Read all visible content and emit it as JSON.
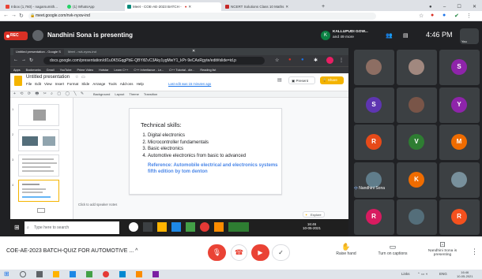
{
  "outer_browser": {
    "tabs": [
      {
        "label": "Inbox (1,760) - nagarsumith..."
      },
      {
        "label": "(1) WhatsApp"
      },
      {
        "label": "Meet - COE-AE-2023 BATCH -"
      },
      {
        "label": "NCERT Solutions Class 10 Maths"
      }
    ],
    "url": "meet.google.com/nvk-nyxw-ind"
  },
  "meet": {
    "rec_label": "REC",
    "presenting_text": "Nandhini Sona is presenting",
    "top_user": {
      "initials": "K",
      "name": "KALLUPUDI GOW...",
      "sub": "and 49 more"
    },
    "time": "4:46 PM",
    "you_label": "You",
    "pinned_name": "Nandhini Sona",
    "meeting_name": "COE-AE-2023 BATCH-QUIZ FOR AUTOMOTIVE ...",
    "raise_hand": "Raise hand",
    "captions": "Turn on captions",
    "present_label": "Nandhini Sona is presenting",
    "participants": [
      {
        "initial": "",
        "color": "#8d6e63"
      },
      {
        "initial": "",
        "color": "#a1887f"
      },
      {
        "initial": "S",
        "color": "#8e24aa"
      },
      {
        "initial": "S",
        "color": "#5e35b1"
      },
      {
        "initial": "",
        "color": "#795548"
      },
      {
        "initial": "Y",
        "color": "#8e24aa"
      },
      {
        "initial": "R",
        "color": "#e64a19"
      },
      {
        "initial": "V",
        "color": "#2e7d32"
      },
      {
        "initial": "M",
        "color": "#ef6c00"
      },
      {
        "initial": "",
        "color": "#607d8b"
      },
      {
        "initial": "K",
        "color": "#ef6c00"
      },
      {
        "initial": "",
        "color": "#78909c"
      },
      {
        "initial": "R",
        "color": "#d81b60"
      },
      {
        "initial": "",
        "color": "#546e7a"
      },
      {
        "initial": "R",
        "color": "#f4511e"
      }
    ]
  },
  "shared": {
    "inner_tabs": [
      {
        "label": "Untitled presentation - Google S"
      },
      {
        "label": "Meet - nvk-nyxw-ind"
      }
    ],
    "inner_url": "docs.google.com/presentation/d/1u0K5GqgPbE-QBYifZvC3Aky1ygMwY1_kPr-9eCAsRgyte/edit#slide=id.p",
    "bookmarks": [
      "Apps",
      "Bookmarks",
      "Gmail",
      "YouTube",
      "Prime Video",
      "Hotstar",
      "Learn C++",
      "C++ Inheritance - Le...",
      "C++ Tutorial - dle...",
      "Reading list"
    ],
    "doc_title": "Untitled presentation",
    "menus": [
      "File",
      "Edit",
      "View",
      "Insert",
      "Format",
      "Slide",
      "Arrange",
      "Tools",
      "Add-ons",
      "Help"
    ],
    "last_edit": "Last edit was 15 minutes ago",
    "present_btn": "Present",
    "share_btn": "Share",
    "toolbar_labels": [
      "Background",
      "Layout",
      "Theme",
      "Transition"
    ],
    "slide": {
      "heading": "Technical skills:",
      "items": [
        "Digital electronics",
        "Microcontroller fundamentals",
        "Basic electronics",
        "Automotive electronics from basic to advanced"
      ],
      "reference": "Reference: Automobile electrical and electronics systems  fifth edition by tom denton"
    },
    "notes": "Click to add speaker notes",
    "explore": "Explore",
    "taskbar_search": "Type here to search",
    "taskbar_time": "16:46",
    "taskbar_date": "10-05-2021"
  },
  "windows_bar": {
    "lang": "ENG",
    "time": "16:46",
    "date": "10-05-2021",
    "links": "Links"
  }
}
